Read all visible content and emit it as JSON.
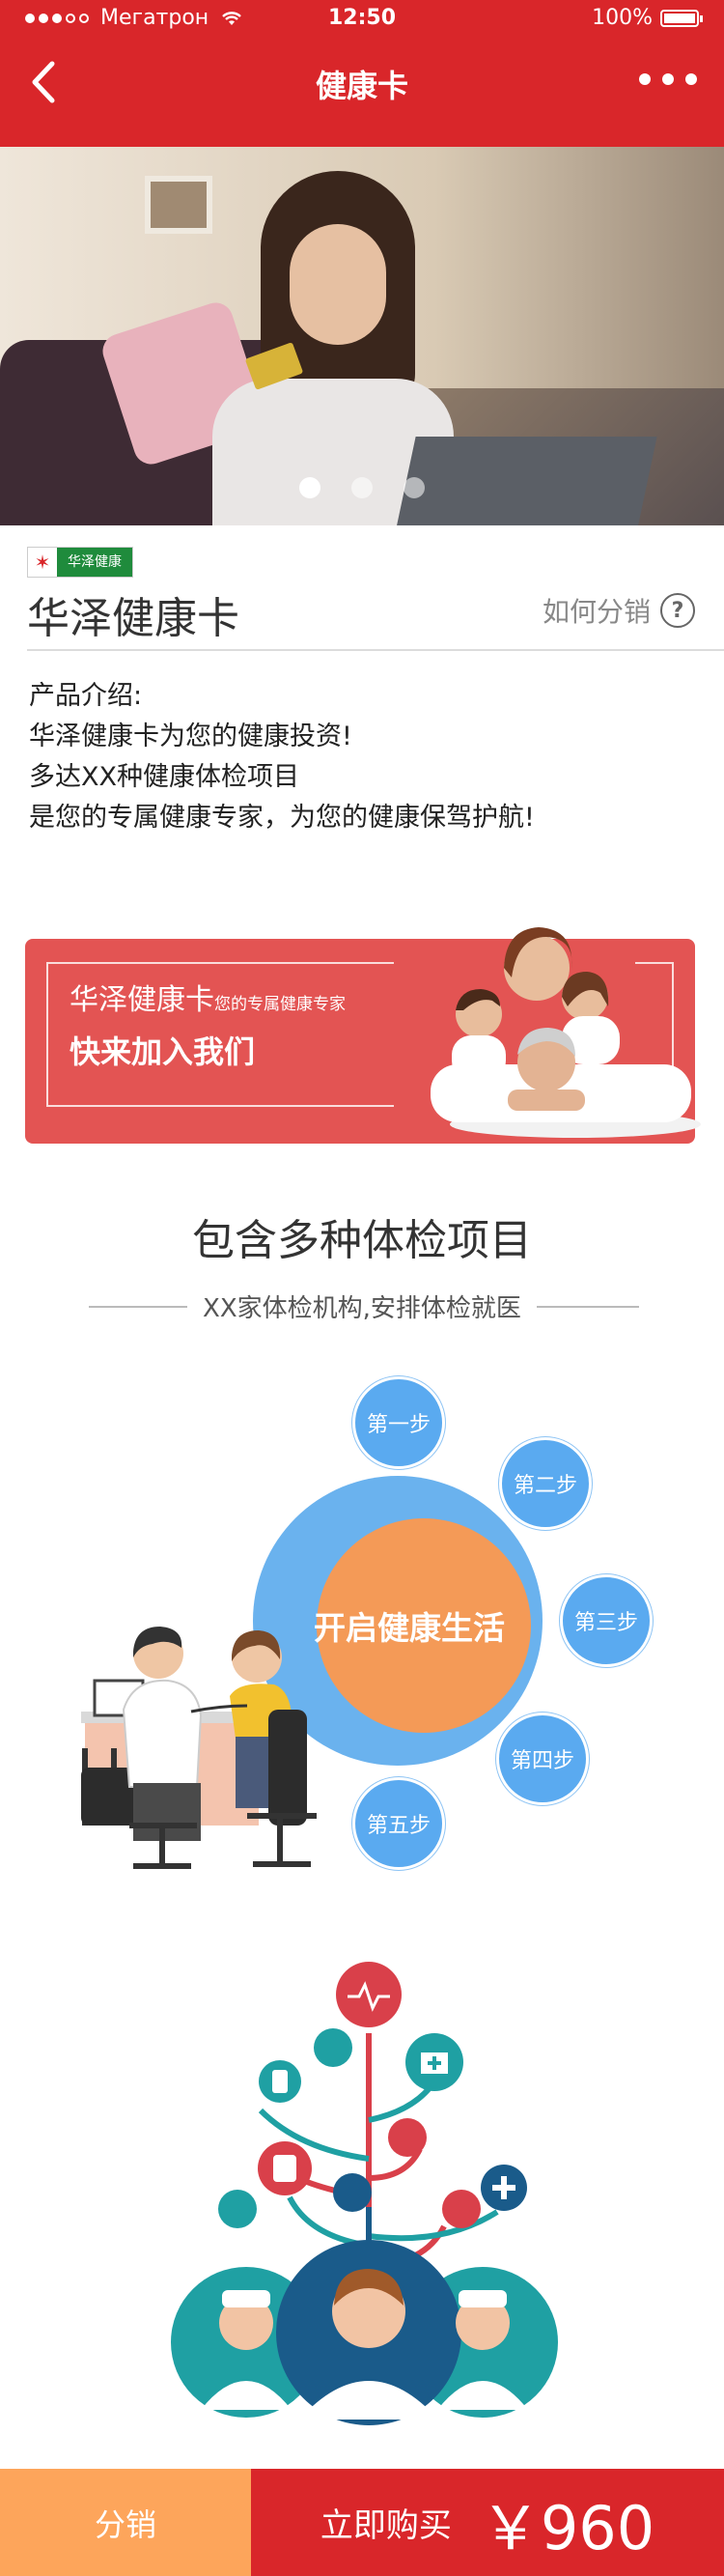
{
  "status_bar": {
    "carrier": "Мегатрон",
    "time": "12:50",
    "battery": "100%"
  },
  "nav": {
    "title": "健康卡",
    "back_icon": "chevron-left-icon",
    "more_icon": "more-dots-icon"
  },
  "banner": {
    "slide_count": 3,
    "active_slide": 1
  },
  "product": {
    "brand_logo_text": "华泽健康",
    "title": "华泽健康卡",
    "share_link": "如何分销",
    "intro_heading": "产品介绍:",
    "intro_lines": [
      "华泽健康卡为您的健康投资!",
      "多达XX种健康体检项目",
      "是您的专属健康专家，为您的健康保驾护航!"
    ]
  },
  "promo": {
    "title": "华泽健康卡",
    "subtitle": "您的专属健康专家",
    "cta": "快来加入我们"
  },
  "section": {
    "title": "包含多种体检项目",
    "subtitle": "XX家体检机构,安排体检就医"
  },
  "steps": {
    "center": "开启健康生活",
    "items": [
      "第一步",
      "第二步",
      "第三步",
      "第四步",
      "第五步"
    ]
  },
  "bottom_bar": {
    "share_label": "分销",
    "buy_label": "立即购买",
    "price": "￥960"
  },
  "colors": {
    "brand_red": "#d9262a",
    "orange": "#fda55b",
    "step_blue": "#5aaaf0",
    "center_orange": "#f49a57"
  }
}
